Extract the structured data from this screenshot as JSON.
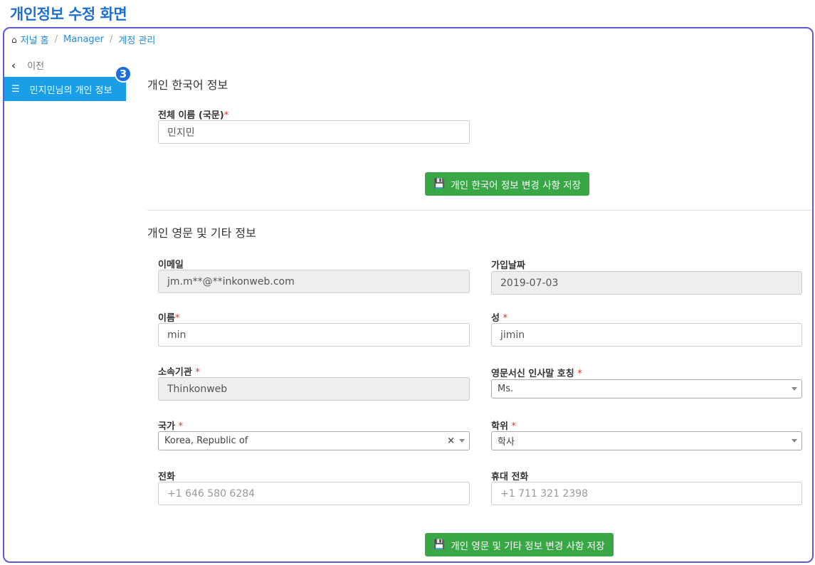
{
  "page_title": "개인정보 수정 화면",
  "breadcrumb": {
    "items": [
      "저널 홈",
      "Manager",
      "계정 관리"
    ]
  },
  "sidebar": {
    "back_label": "이전",
    "active_item": "민지민님의 개인 정보",
    "badge": "3"
  },
  "section1": {
    "title": "개인 한국어 정보",
    "full_name_label": "전체 이름 (국문)",
    "full_name_value": "민지민",
    "save_label": "개인 한국어 정보 변경 사항 저장"
  },
  "section2": {
    "title": "개인 영문 및 기타 정보",
    "email_label": "이메일",
    "email_value": "jm.m**@**inkonweb.com",
    "join_date_label": "가입날짜",
    "join_date_value": "2019-07-03",
    "first_name_label": "이름",
    "first_name_value": "min",
    "last_name_label": "성",
    "last_name_value": "jimin",
    "affiliation_label": "소속기관",
    "affiliation_value": "Thinkonweb",
    "salutation_label": "영문서신 인사말 호칭",
    "salutation_value": "Ms.",
    "country_label": "국가",
    "country_value": "Korea, Republic of",
    "degree_label": "학위",
    "degree_value": "학사",
    "phone_label": "전화",
    "phone_placeholder": "+1 646 580 6284",
    "mobile_label": "휴대 전화",
    "mobile_placeholder": "+1 711 321 2398",
    "save_label": "개인 영문 및 기타 정보 변경 사항 저장"
  },
  "required_mark": "*",
  "colors": {
    "accent": "#1a9ee6",
    "save_button": "#3aa746",
    "required": "#d9332b",
    "frame": "#5b5bd6"
  }
}
